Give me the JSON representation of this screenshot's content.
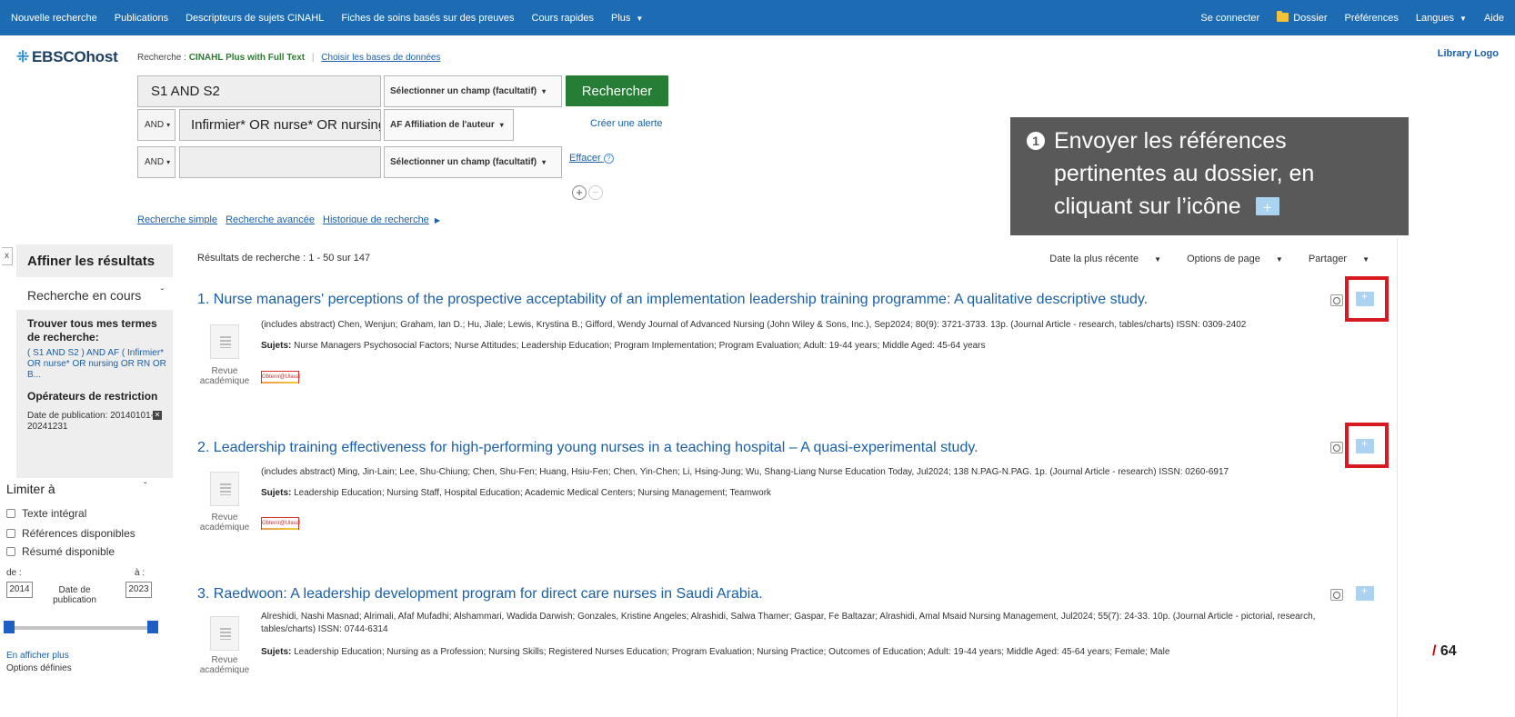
{
  "topnav": {
    "left": [
      "Nouvelle recherche",
      "Publications",
      "Descripteurs de sujets CINAHL",
      "Fiches de soins basés sur des preuves",
      "Cours rapides",
      "Plus"
    ],
    "right": [
      "Se connecter",
      "Dossier",
      "Préférences",
      "Langues",
      "Aide"
    ]
  },
  "header": {
    "logo": "EBSCOhost",
    "search_label": "Recherche :",
    "database": "CINAHL Plus with Full Text",
    "choose_db": "Choisir les bases de données",
    "library_logo": "Library Logo"
  },
  "search": {
    "row1": {
      "value": "S1 AND S2",
      "field": "Sélectionner un champ (facultatif)"
    },
    "row2": {
      "op": "AND",
      "value": "Infirmier* OR nurse* OR nursing OR RI",
      "field": "AF Affiliation de l'auteur"
    },
    "row3": {
      "op": "AND",
      "value": "",
      "field": "Sélectionner un champ (facultatif)"
    },
    "button": "Rechercher",
    "create_alert": "Créer une alerte",
    "clear": "Effacer",
    "help": "?",
    "links": [
      "Recherche simple",
      "Recherche avancée",
      "Historique de recherche"
    ]
  },
  "callout": {
    "num": "1",
    "line1": "Envoyer les références",
    "line2": "pertinentes au dossier, en",
    "line3": "cliquant sur l’icône"
  },
  "sidebar": {
    "title": "Affiner les résultats",
    "current": "Recherche en cours",
    "find_all": "Trouver tous mes termes de recherche:",
    "query": "( S1 AND S2 ) AND AF ( Infirmier* OR nurse* OR nursing OR RN OR B...",
    "restrict": "Opérateurs de restriction",
    "date_pub": "Date de publication: 20140101-20241231",
    "limit": "Limiter à",
    "checkboxes": [
      "Texte intégral",
      "Références disponibles",
      "Résumé disponible"
    ],
    "from": "de :",
    "to": "à :",
    "from_val": "2014",
    "to_val": "2023",
    "date_label": "Date de publication",
    "show_more": "En afficher plus",
    "defined_options": "Options définies"
  },
  "results": {
    "header": "Résultats de recherche : 1 - 50 sur 147",
    "sort": [
      "Date la plus récente",
      "Options de page",
      "Partager"
    ],
    "items": [
      {
        "num": "1.",
        "title": "Nurse managers' perceptions of the prospective acceptability of an implementation leadership training programme: A qualitative descriptive study.",
        "meta": "(includes abstract) Chen, Wenjun; Graham, Ian D.; Hu, Jiale; Lewis, Krystina B.; Gifford, Wendy Journal of Advanced Nursing (John Wiley & Sons, Inc.), Sep2024; 80(9): 3721-3733. 13p. (Journal Article - research, tables/charts) ISSN: 0309-2402",
        "subjects_label": "Sujets:",
        "subjects": "Nurse Managers Psychosocial Factors; Nurse Attitudes; Leadership Education; Program Implementation; Program Evaluation; Adult: 19-44 years; Middle Aged: 45-64 years",
        "type": "Revue académique",
        "getit": "Obtenir@Ulaval"
      },
      {
        "num": "2.",
        "title": "Leadership training effectiveness for high-performing young nurses in a teaching hospital – A quasi-experimental study.",
        "meta": "(includes abstract) Ming, Jin-Lain; Lee, Shu-Chiung; Chen, Shu-Fen; Huang, Hsiu-Fen; Chen, Yin-Chen; Li, Hsing-Jung; Wu, Shang-Liang Nurse Education Today, Jul2024; 138 N.PAG-N.PAG. 1p. (Journal Article - research) ISSN: 0260-6917",
        "subjects_label": "Sujets:",
        "subjects": "Leadership Education; Nursing Staff, Hospital Education; Academic Medical Centers; Nursing Management; Teamwork",
        "type": "Revue académique",
        "getit": "Obtenir@Ulaval"
      },
      {
        "num": "3.",
        "title": "Raedwoon: A leadership development program for direct care nurses in Saudi Arabia.",
        "meta": "Alreshidi, Nashi Masnad; Alrimali, Afaf Mufadhi; Alshammari, Wadida Darwish; Gonzales, Kristine Angeles; Alrashidi, Salwa Thamer; Gaspar, Fe Baltazar; Alrashidi, Amal Msaid Nursing Management, Jul2024; 55(7): 24-33. 10p. (Journal Article - pictorial, research, tables/charts) ISSN: 0744-6314",
        "subjects_label": "Sujets:",
        "subjects": "Leadership Education; Nursing as a Profession; Nursing Skills; Registered Nurses Education; Program Evaluation; Nursing Practice; Outcomes of Education; Adult: 19-44 years; Middle Aged: 45-64 years; Female; Male",
        "type": "Revue académique"
      }
    ]
  },
  "page_number": "64",
  "page_slash": "/",
  "colors": {
    "nav": "#1d6cb3",
    "search_button": "#267e36",
    "highlight": "#d71920",
    "callout": "#595959"
  }
}
